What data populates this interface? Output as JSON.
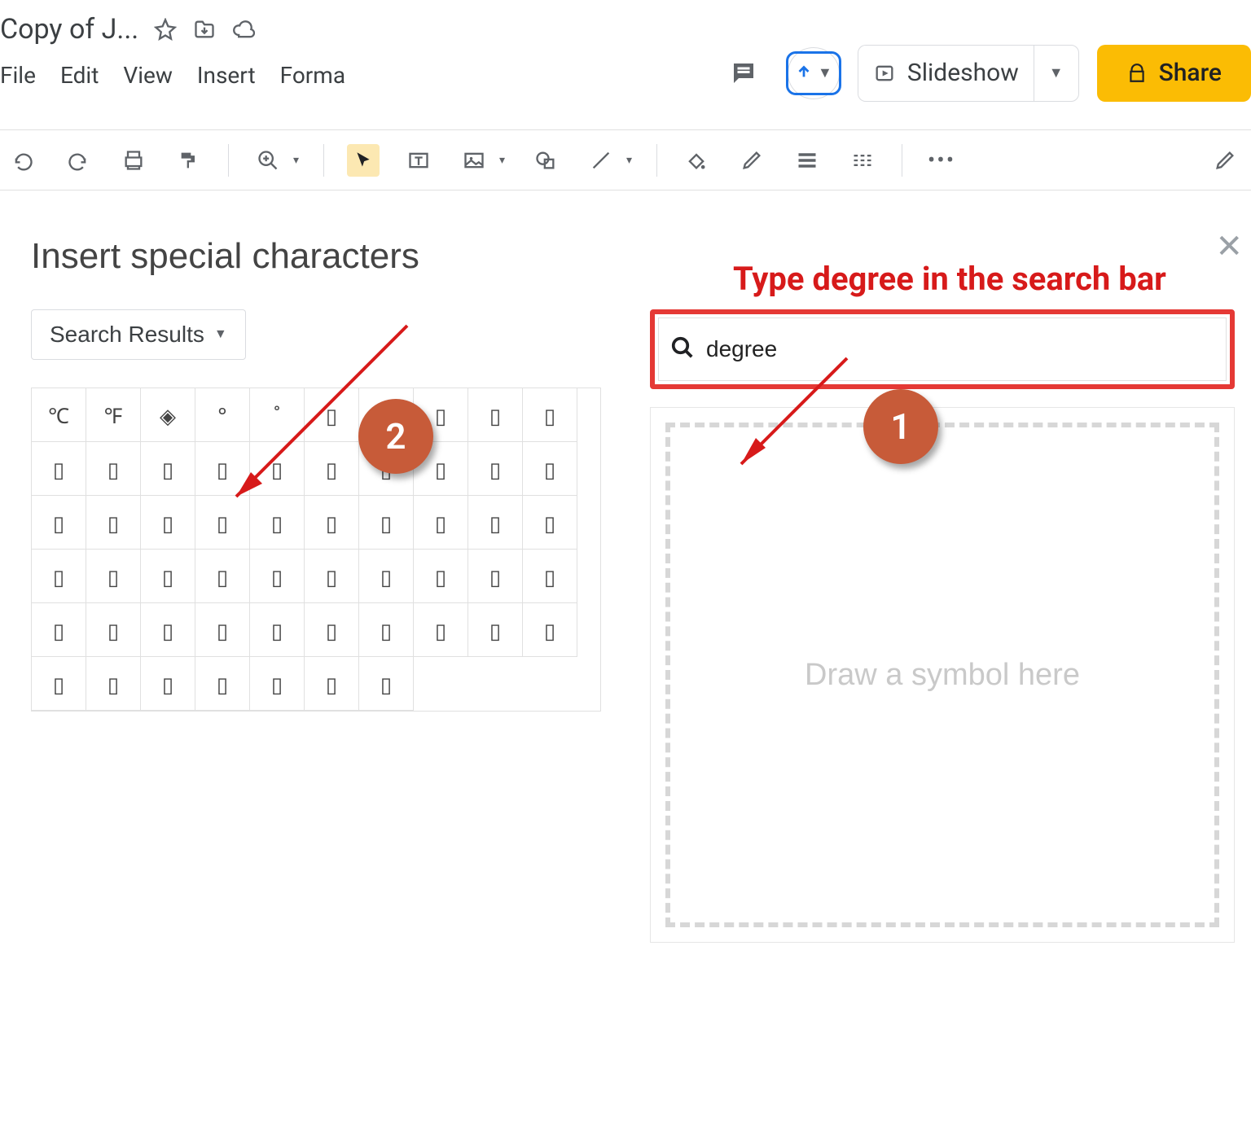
{
  "header": {
    "doc_title": "Copy of J...",
    "menus": [
      "File",
      "Edit",
      "View",
      "Insert",
      "Forma"
    ],
    "slideshow_label": "Slideshow",
    "share_label": "Share"
  },
  "dialog": {
    "title": "Insert special characters",
    "dropdown_label": "Search Results",
    "search_value": "degree",
    "draw_placeholder": "Draw a symbol here",
    "grid": [
      [
        "℃",
        "℉",
        "◈",
        "°",
        "˚",
        "▯",
        "▯",
        "▯",
        "▯",
        "▯"
      ],
      [
        "▯",
        "▯",
        "▯",
        "▯",
        "▯",
        "▯",
        "▯",
        "▯",
        "▯",
        "▯"
      ],
      [
        "▯",
        "▯",
        "▯",
        "▯",
        "▯",
        "▯",
        "▯",
        "▯",
        "▯",
        "▯"
      ],
      [
        "▯",
        "▯",
        "▯",
        "▯",
        "▯",
        "▯",
        "▯",
        "▯",
        "▯",
        "▯"
      ],
      [
        "▯",
        "▯",
        "▯",
        "▯",
        "▯",
        "▯",
        "▯",
        "▯",
        "▯",
        "▯"
      ],
      [
        "▯",
        "▯",
        "▯",
        "▯",
        "▯",
        "▯",
        "▯",
        "",
        "",
        ""
      ]
    ]
  },
  "annotations": {
    "instruction": "Type degree in the search bar",
    "badge1": "1",
    "badge2": "2"
  }
}
